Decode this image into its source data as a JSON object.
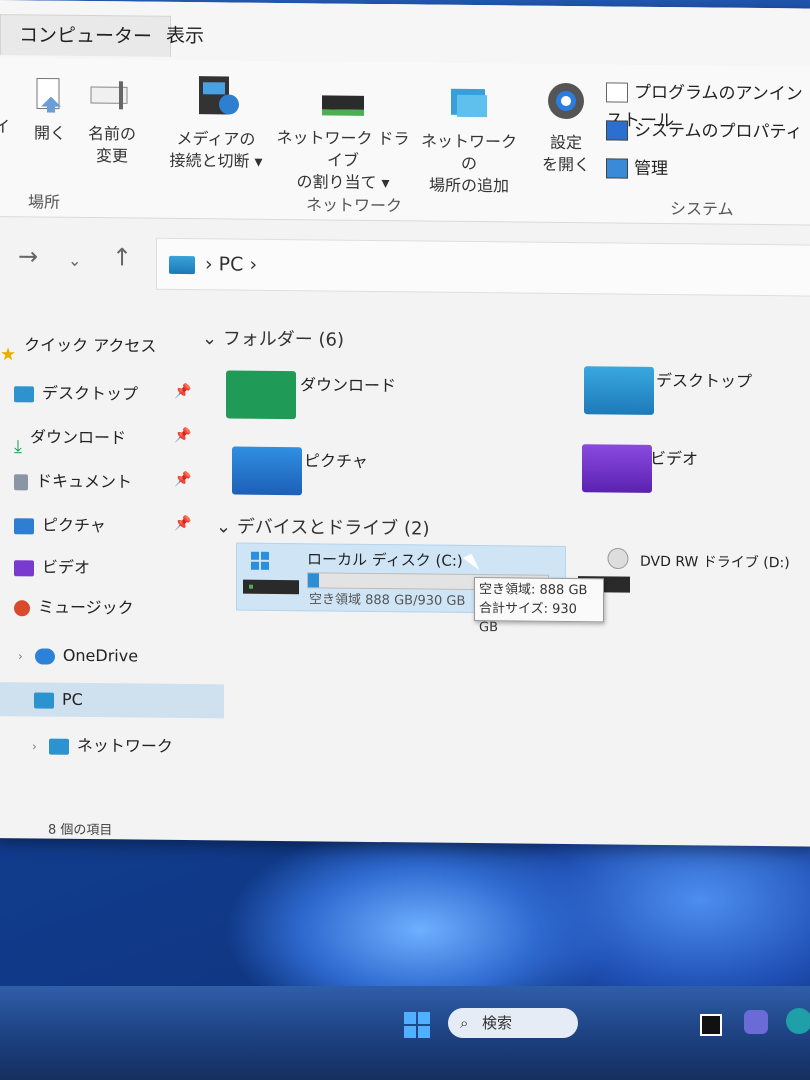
{
  "tabs": [
    "コンピューター",
    "表示"
  ],
  "ribbon": {
    "location_group_label": "場所",
    "network_group_label": "ネットワーク",
    "system_group_label": "システム",
    "cut_label": "イ",
    "open_label_1": "開く",
    "rename_label_1": "名前の",
    "rename_label_2": "変更",
    "media_label_1": "メディアの",
    "media_label_2": "接続と切断 ▾",
    "map_drive_label_1": "ネットワーク ドライブ",
    "map_drive_label_2": "の割り当て ▾",
    "add_location_label_1": "ネットワークの",
    "add_location_label_2": "場所の追加",
    "settings_label_1": "設定",
    "settings_label_2": "を開く",
    "uninstall_label": "プログラムのアンインストール",
    "sysprops_label": "システムのプロパティ",
    "manage_label": "管理"
  },
  "nav": {
    "path_root": "PC",
    "sep": "›"
  },
  "sidebar": {
    "quick_access": "クイック アクセス",
    "items": [
      "デスクトップ",
      "ダウンロード",
      "ドキュメント",
      "ピクチャ",
      "ビデオ",
      "ミュージック"
    ],
    "onedrive": "OneDrive",
    "pc": "PC",
    "network": "ネットワーク"
  },
  "status": "8 個の項目",
  "folders_header": "フォルダー (6)",
  "folders": [
    "ダウンロード",
    "デスクトップ",
    "ピクチャ",
    "ビデオ"
  ],
  "drives_header": "デバイスとドライブ (2)",
  "drive_c": {
    "name": "ローカル ディスク (C:)",
    "free_text": "空き領域 888 GB/930 GB",
    "used_fraction": 0.045
  },
  "drive_d": {
    "name": "DVD RW ドライブ (D:)"
  },
  "tooltip": {
    "line1": "空き領域: 888 GB",
    "line2": "合計サイズ: 930 GB"
  },
  "taskbar": {
    "search_label": "検索"
  },
  "colors": {
    "accent": "#2c8fd6",
    "selection": "#cfe4f5",
    "wallpaper": "#1a4a98"
  }
}
